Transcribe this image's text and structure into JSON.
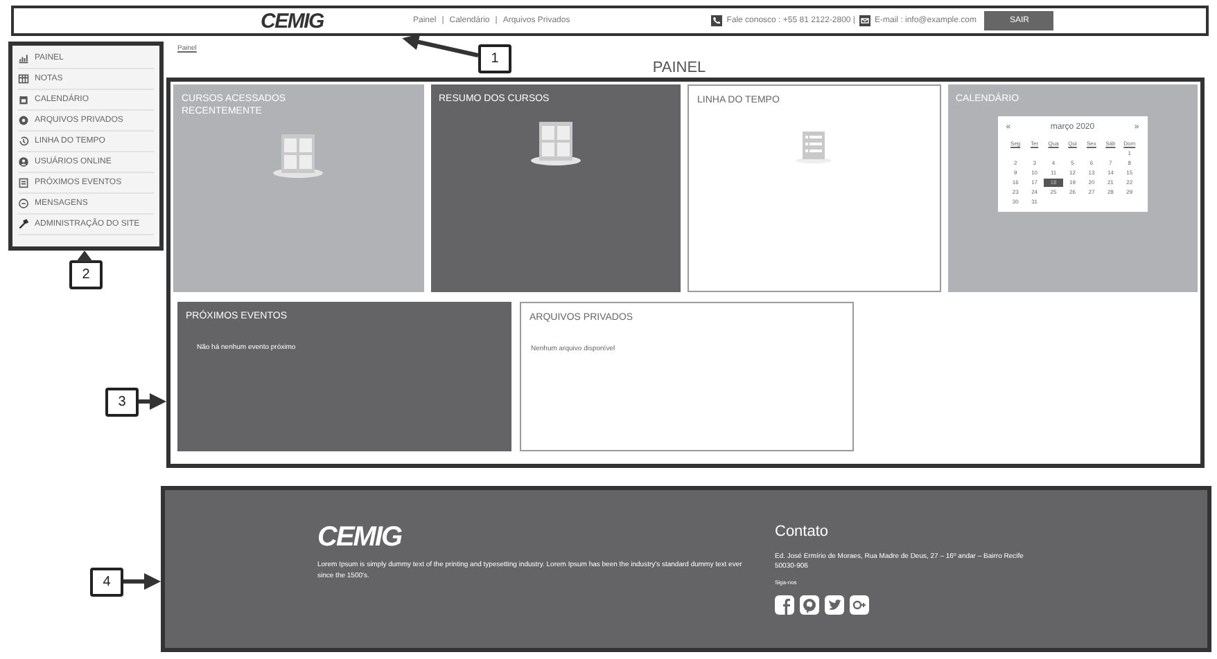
{
  "header": {
    "logo": "CEMIG",
    "nav": [
      {
        "label": "Painel"
      },
      {
        "label": "Calendário"
      },
      {
        "label": "Arquivos Privados"
      }
    ],
    "separator": "|",
    "phone": "Fale conosco : +55 81 2122-2800 |",
    "email": "E-mail : info@example.com",
    "logout": "SAIR"
  },
  "sidebar": {
    "items": [
      {
        "label": "PAINEL",
        "kind": "chart"
      },
      {
        "label": "NOTAS",
        "kind": "table"
      },
      {
        "label": "CALENDÁRIO",
        "kind": "calendar"
      },
      {
        "label": "ARQUIVOS PRIVADOS",
        "kind": "disc"
      },
      {
        "label": "LINHA DO TEMPO",
        "kind": "history"
      },
      {
        "label": "USUÁRIOS ONLINE",
        "kind": "user"
      },
      {
        "label": "PRÓXIMOS EVENTOS",
        "kind": "events"
      },
      {
        "label": "MENSAGENS",
        "kind": "message"
      },
      {
        "label": "ADMINISTRAÇÃO DO SITE",
        "kind": "wrench"
      }
    ]
  },
  "breadcrumb": "Painel",
  "page_title": "PAINEL",
  "cards_top": [
    {
      "title": "CURSOS ACESSADOS RECENTEMENTE",
      "kind": "courses",
      "color": "#b1b2b6"
    },
    {
      "title": "RESUMO DOS CURSOS",
      "kind": "courses",
      "color": "#646466"
    },
    {
      "title": "LINHA DO TEMPO",
      "kind": "timeline",
      "color": "#ffffff"
    },
    {
      "title": "CALENDÁRIO",
      "kind": "calendar",
      "color": "#b1b2b6"
    }
  ],
  "calendar": {
    "prev": "«",
    "month": "março 2020",
    "next": "»",
    "weekdays": [
      "Seg",
      "Ter",
      "Qua",
      "Qui",
      "Sex",
      "Sáb",
      "Dom"
    ],
    "weeks": [
      [
        {
          "day": "1",
          "selected": false
        }
      ],
      [
        {
          "day": "2",
          "selected": false
        },
        {
          "day": "3",
          "selected": false
        },
        {
          "day": "4",
          "selected": false
        },
        {
          "day": "5",
          "selected": false
        },
        {
          "day": "6",
          "selected": false
        },
        {
          "day": "7",
          "selected": false
        },
        {
          "day": "8",
          "selected": false
        }
      ],
      [
        {
          "day": "9",
          "selected": false
        },
        {
          "day": "10",
          "selected": false
        },
        {
          "day": "11",
          "selected": false
        },
        {
          "day": "12",
          "selected": false
        },
        {
          "day": "13",
          "selected": false
        },
        {
          "day": "14",
          "selected": false
        },
        {
          "day": "15",
          "selected": false
        }
      ],
      [
        {
          "day": "16",
          "selected": false
        },
        {
          "day": "17",
          "selected": false
        },
        {
          "day": "18",
          "selected": true
        },
        {
          "day": "19",
          "selected": false
        },
        {
          "day": "20",
          "selected": false
        },
        {
          "day": "21",
          "selected": false
        },
        {
          "day": "22",
          "selected": false
        }
      ],
      [
        {
          "day": "23",
          "selected": false
        },
        {
          "day": "24",
          "selected": false
        },
        {
          "day": "25",
          "selected": false
        },
        {
          "day": "26",
          "selected": false
        },
        {
          "day": "27",
          "selected": false
        },
        {
          "day": "28",
          "selected": false
        },
        {
          "day": "29",
          "selected": false
        }
      ],
      [
        {
          "day": "30",
          "selected": false
        },
        {
          "day": "31",
          "selected": false
        }
      ]
    ]
  },
  "cards_bottom": [
    {
      "title": "PRÓXIMOS EVENTOS",
      "text": "Não há nenhum evento próximo",
      "color": "#646466"
    },
    {
      "title": "ARQUIVOS PRIVADOS",
      "text": "Nenhum arquivo disponível",
      "color": "#ffffff"
    }
  ],
  "footer": {
    "logo": "CEMIG",
    "text": "Lorem Ipsum is simply dummy text of the printing and typesetting industry. Lorem Ipsum has been the industry's standard dummy text ever since the 1500's.",
    "contact_title": "Contato",
    "address": "Ed. José Ermírio de Moraes, Rua Madre de Deus, 27 – 16º andar – Bairro Recife",
    "zip": "50030-906",
    "follow": "Siga-nos",
    "social": [
      {
        "kind": "facebook"
      },
      {
        "kind": "pinterest"
      },
      {
        "kind": "twitter"
      },
      {
        "kind": "google"
      }
    ]
  },
  "callouts": [
    "1",
    "2",
    "3",
    "4"
  ]
}
